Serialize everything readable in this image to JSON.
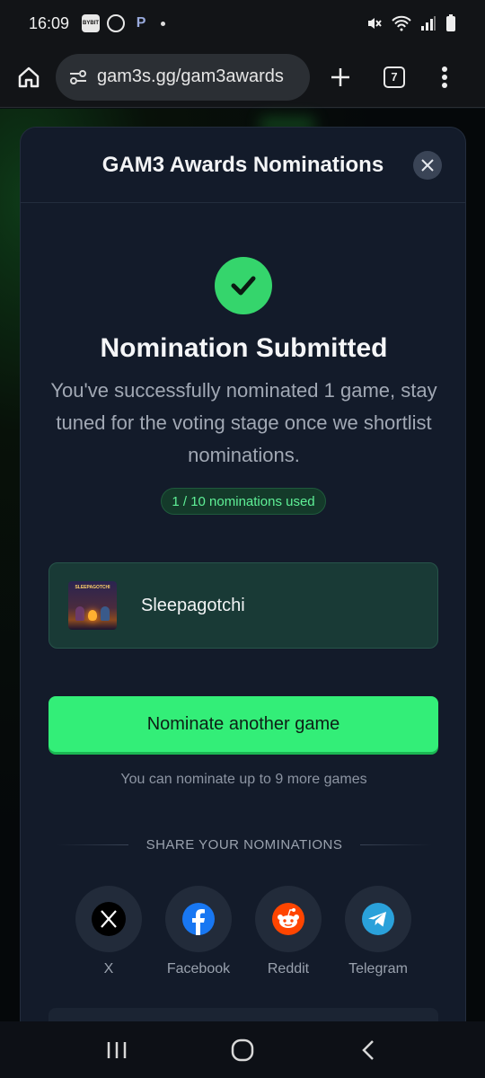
{
  "status_bar": {
    "time": "16:09",
    "app_badge": "BYBIT",
    "icons": [
      "bybit-icon",
      "viber-icon",
      "picsart-icon",
      "dot-icon",
      "mute-icon",
      "wifi-icon",
      "signal-icon",
      "battery-icon"
    ]
  },
  "browser": {
    "url": "gam3s.gg/gam3awards",
    "tab_count": "7"
  },
  "modal": {
    "title": "GAM3 Awards Nominations",
    "success_title": "Nomination Submitted",
    "success_description": "You've successfully nominated 1 game, stay tuned for the voting stage once we shortlist nominations.",
    "usage_badge": "1 / 10 nominations used",
    "nominated_game": {
      "name": "Sleepagotchi",
      "thumb_text": "SLEEPAGOTCHI"
    },
    "nominate_button": "Nominate another game",
    "remaining_text": "You can nominate up to 9 more games",
    "share_heading": "SHARE YOUR NOMINATIONS",
    "share_options": [
      {
        "label": "X",
        "icon": "x-icon",
        "color": "#000000"
      },
      {
        "label": "Facebook",
        "icon": "facebook-icon",
        "color": "#1877f2"
      },
      {
        "label": "Reddit",
        "icon": "reddit-icon",
        "color": "#ff4500"
      },
      {
        "label": "Telegram",
        "icon": "telegram-icon",
        "color": "#2aa1da"
      }
    ]
  },
  "colors": {
    "accent_green": "#33ee78",
    "modal_bg": "#131b2a",
    "badge_text": "#5ff097"
  }
}
